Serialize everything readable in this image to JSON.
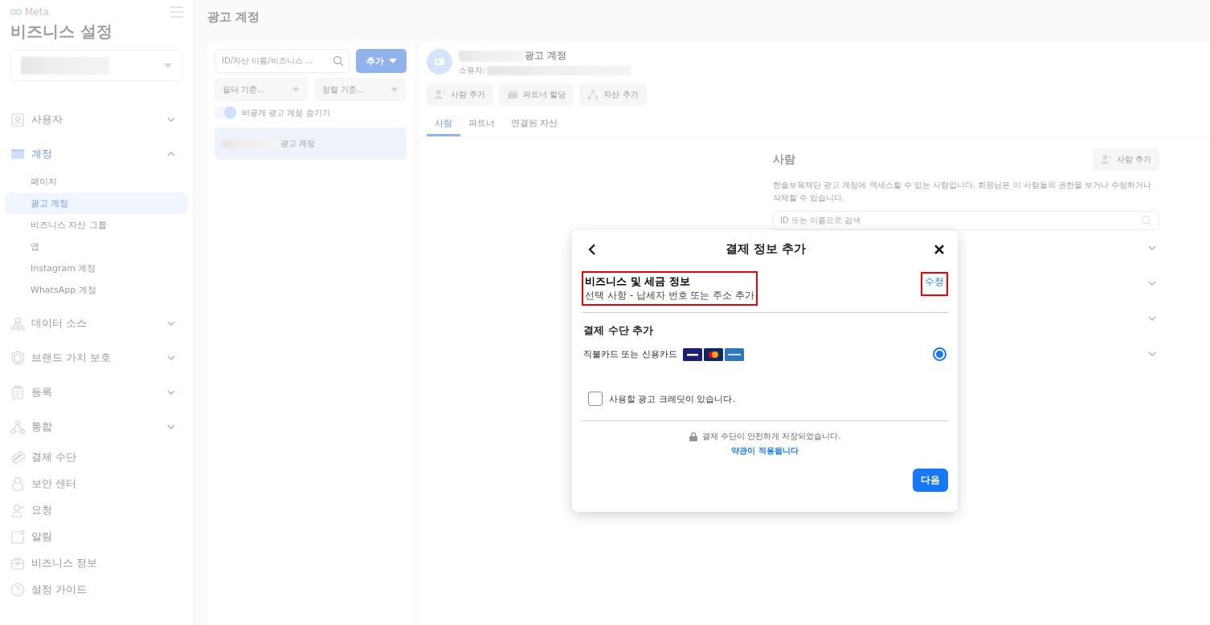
{
  "sidebar": {
    "brand": "Meta",
    "title": "비즈니스 설정",
    "items": [
      {
        "label": "사용자",
        "selected": false,
        "expanded": false
      },
      {
        "label": "계정",
        "selected": true,
        "expanded": true,
        "children": [
          {
            "label": "페이지",
            "selected": false
          },
          {
            "label": "광고 계정",
            "selected": true
          },
          {
            "label": "비즈니스 자산 그룹",
            "selected": false
          },
          {
            "label": "앱",
            "selected": false
          },
          {
            "label": "Instagram 계정",
            "selected": false
          },
          {
            "label": "WhatsApp 계정",
            "selected": false
          }
        ]
      },
      {
        "label": "데이터 소스",
        "selected": false,
        "expanded": false
      },
      {
        "label": "브랜드 가치 보호",
        "selected": false,
        "expanded": false
      },
      {
        "label": "등록",
        "selected": false,
        "expanded": false
      },
      {
        "label": "통합",
        "selected": false,
        "expanded": false
      },
      {
        "label": "결제 수단",
        "selected": false
      },
      {
        "label": "보안 센터",
        "selected": false
      },
      {
        "label": "요청",
        "selected": false
      },
      {
        "label": "알림",
        "selected": false
      },
      {
        "label": "비즈니스 정보",
        "selected": false
      },
      {
        "label": "설정 가이드",
        "selected": false
      }
    ]
  },
  "page_title": "광고 계정",
  "list_panel": {
    "search": {
      "placeholder": "ID/자산 이름/비즈니스 ..."
    },
    "add_button": "추가",
    "filters": [
      "필터 기준...",
      "정렬 기준..."
    ],
    "toggle": {
      "label": "비공개 광고 계정 숨기기",
      "on": true
    },
    "accounts": [
      {
        "label": "광고 계정",
        "selected": true
      }
    ]
  },
  "detail": {
    "title": "광고 계정",
    "owner_label": "소유자:",
    "actions": [
      "사람 추가",
      "파트너 할당",
      "자산 추가"
    ],
    "tabs": [
      {
        "label": "사람",
        "selected": true
      },
      {
        "label": "파트너",
        "selected": false
      },
      {
        "label": "연결된 자산",
        "selected": false
      }
    ],
    "people": {
      "title": "사람",
      "add_button": "사람 추가",
      "description": "한솔보육재단 광고 계정에 액세스할 수 있는 사람입니다. 회원님은 이 사람들의 권한을 보거나 수정하거나 삭제할 수 있습니다.",
      "search": {
        "placeholder": "ID 또는 이름으로 검색"
      },
      "rows": [
        {
          "expanded": false
        },
        {
          "expanded": false
        },
        {
          "expanded": false
        },
        {
          "expanded": false
        }
      ]
    }
  },
  "modal": {
    "title": "결제 정보 추가",
    "tax": {
      "title": "비즈니스 및 세금 정보",
      "subtitle": "선택 사항 - 납세자 번호 또는 주소 추가",
      "highlighted": true
    },
    "edit_link": {
      "label": "수정",
      "highlighted": true
    },
    "section_title": "결제 수단 추가",
    "option": {
      "label": "직불카드 또는 신용카드",
      "selected": true
    },
    "credit": {
      "label": "사용할 광고 크레딧이 있습니다.",
      "checked": false
    },
    "secure_note": "결제 수단이 안전하게 저장되었습니다.",
    "terms_link": "약관이 적용됩니다",
    "next_button": "다음"
  }
}
